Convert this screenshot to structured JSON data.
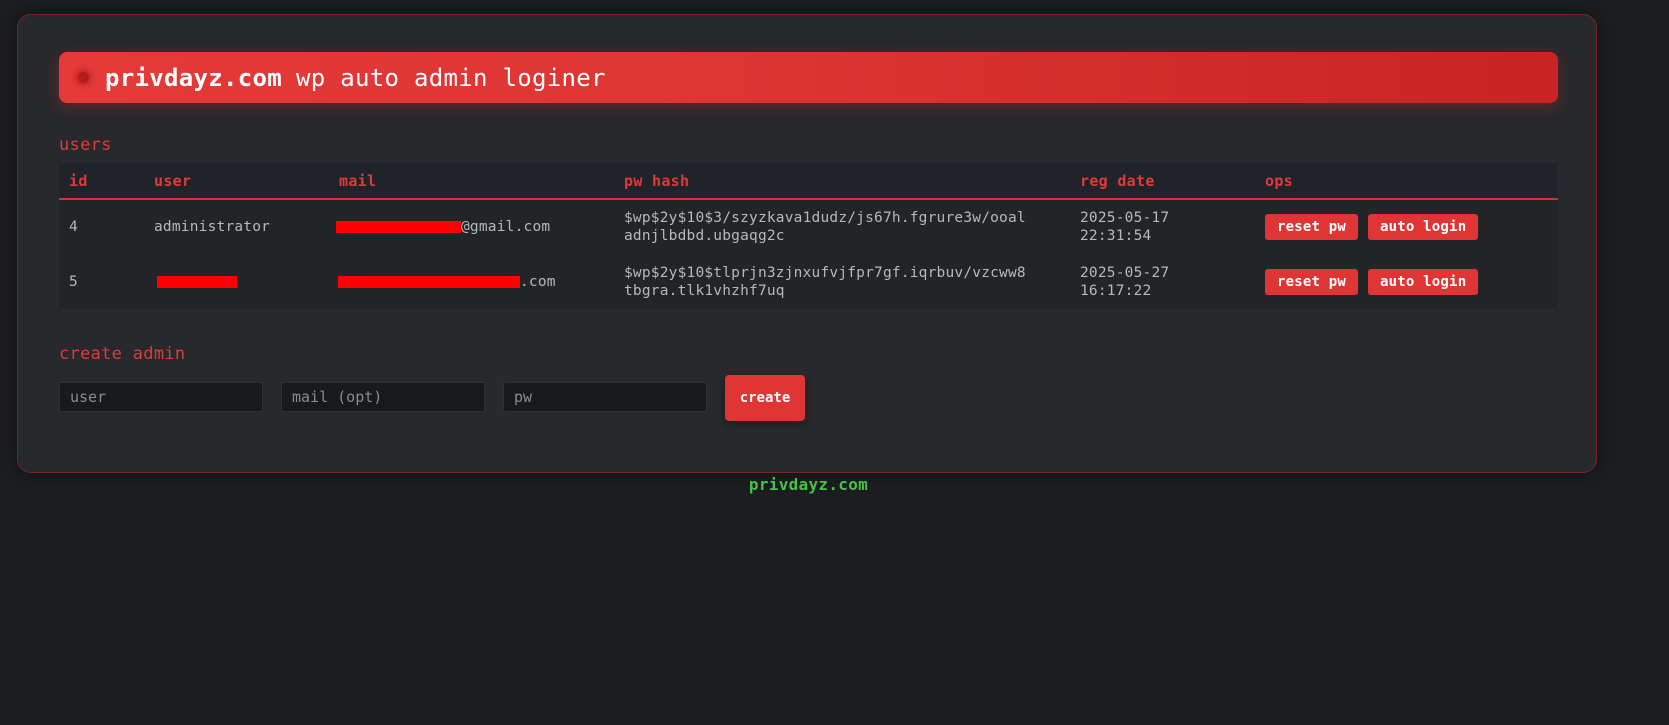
{
  "header": {
    "brand": "privdayz.com",
    "subtitle": "wp auto admin loginer"
  },
  "users_section": {
    "title": "users",
    "columns": [
      "id",
      "user",
      "mail",
      "pw hash",
      "reg date",
      "ops"
    ],
    "rows": [
      {
        "id": "4",
        "user": "administrator",
        "mail_visible": "@gmail.com",
        "pw_hash": "$wp$2y$10$3/szyzkava1dudz/js67h.fgrure3w/ooaladnjlbdbd.ubgaqg2c",
        "pw_hash_line1": "$wp$2y$10$3/szyzkava1dudz/js67h.fgrure3w/ooal",
        "pw_hash_line2": "adnjlbdbd.ubgaqg2c",
        "reg_date": "2025-05-17",
        "reg_time": "22:31:54",
        "reset_label": "reset pw",
        "login_label": "auto login"
      },
      {
        "id": "5",
        "user": "",
        "mail_visible": ".com",
        "pw_hash": "$wp$2y$10$tlprjn3zjnxufvjfpr7gf.iqrbuv/vzcww8tbgra.tlk1vhzhf7uq",
        "pw_hash_line1": "$wp$2y$10$tlprjn3zjnxufvjfpr7gf.iqrbuv/vzcww8",
        "pw_hash_line2": "tbgra.tlk1vhzhf7uq",
        "reg_date": "2025-05-27",
        "reg_time": "16:17:22",
        "reset_label": "reset pw",
        "login_label": "auto login"
      }
    ]
  },
  "create_section": {
    "title": "create admin",
    "user_placeholder": "user",
    "mail_placeholder": "mail (opt)",
    "pw_placeholder": "pw",
    "create_label": "create"
  },
  "footer": {
    "text": "privdayz.com"
  },
  "colors": {
    "accent": "#e03535",
    "footer_green": "#46c246",
    "background": "#1c1d20",
    "panel": "#28292c"
  }
}
